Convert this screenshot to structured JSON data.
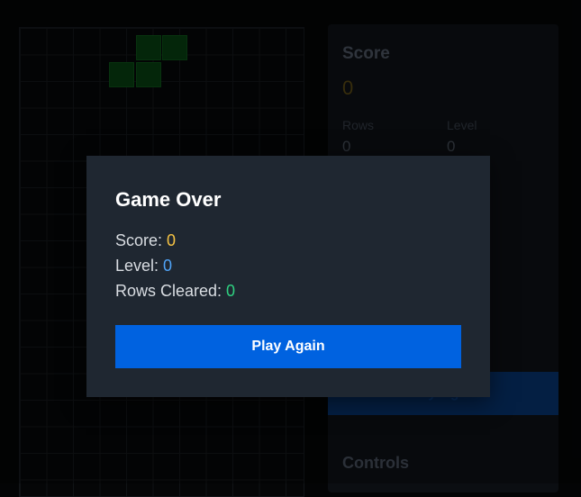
{
  "board": {
    "cell_color": "#06330e",
    "piece": "S-tetromino"
  },
  "side_panel": {
    "score_title": "Score",
    "score_value": "0",
    "rows_label": "Rows",
    "rows_value": "0",
    "level_label": "Level",
    "level_value": "0",
    "play_button_label": "Play Again",
    "controls_title": "Controls"
  },
  "modal": {
    "title": "Game Over",
    "score_label": "Score: ",
    "score_value": "0",
    "level_label": "Level: ",
    "level_value": "0",
    "rows_label": "Rows Cleared: ",
    "rows_value": "0",
    "play_again_label": "Play Again"
  },
  "colors": {
    "background": "#030405",
    "modal_bg": "#1f2731",
    "accent": "#0062e0",
    "score": "#f6c344",
    "level": "#4fa3f7",
    "rows": "#2fd181"
  }
}
